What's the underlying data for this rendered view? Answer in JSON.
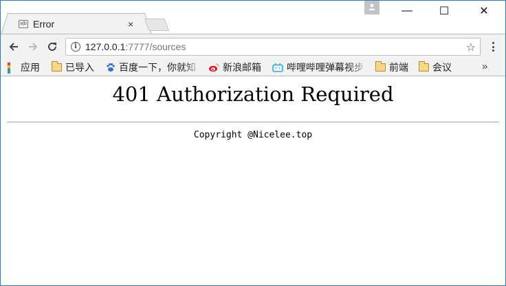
{
  "tab": {
    "title": "Error",
    "favicon_text": "a|b",
    "close_glyph": "×"
  },
  "window": {
    "minimize_glyph": "—",
    "maximize_glyph": "☐",
    "close_glyph": "✕"
  },
  "address_bar": {
    "host": "127.0.0.1",
    "rest": ":7777/sources"
  },
  "bookmarks": {
    "apps": "应用",
    "imported": "已导入",
    "baidu": "百度一下，你就知",
    "sina": "新浪邮箱",
    "bilibili": "哔哩哔哩弹幕视步",
    "frontend": "前端",
    "meeting": "会议",
    "more": "»"
  },
  "page": {
    "heading": "401 Authorization Required",
    "footer": "Copyright @Nicelee.top"
  },
  "colors": {
    "window_border": "#2b79c9",
    "toolbar_bg": "#f2f2f2",
    "folder": "#f7d88a"
  }
}
